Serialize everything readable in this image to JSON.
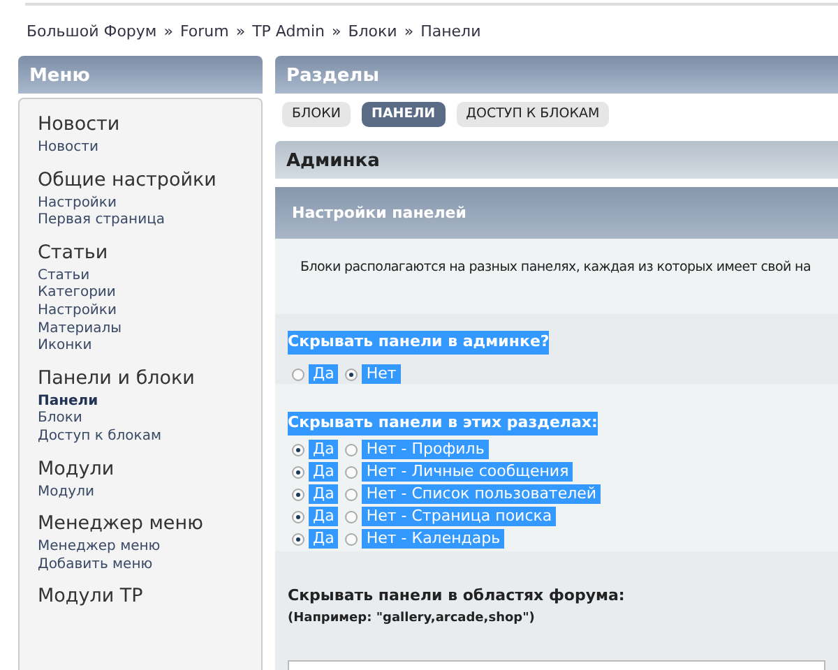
{
  "breadcrumb": {
    "separator": "»",
    "items": [
      "Большой Форум",
      "Forum",
      "TP Admin",
      "Блоки",
      "Панели"
    ]
  },
  "sidebar": {
    "title": "Меню",
    "sections": [
      {
        "title": "Новости",
        "items": [
          {
            "label": "Новости",
            "selected": false
          }
        ]
      },
      {
        "title": "Общие настройки",
        "items": [
          {
            "label": "Настройки",
            "selected": false
          },
          {
            "label": "Первая страница",
            "selected": false
          }
        ]
      },
      {
        "title": "Статьи",
        "items": [
          {
            "label": "Статьи",
            "selected": false
          },
          {
            "label": "Категории",
            "selected": false
          },
          {
            "label": "Настройки",
            "selected": false
          },
          {
            "label": "Материалы",
            "selected": false
          },
          {
            "label": "Иконки",
            "selected": false
          }
        ]
      },
      {
        "title": "Панели и блоки",
        "items": [
          {
            "label": "Панели",
            "selected": true
          },
          {
            "label": "Блоки",
            "selected": false
          },
          {
            "label": "Доступ к блокам",
            "selected": false
          }
        ]
      },
      {
        "title": "Модули",
        "items": [
          {
            "label": "Модули",
            "selected": false
          }
        ]
      },
      {
        "title": "Менеджер меню",
        "items": [
          {
            "label": "Менеджер меню",
            "selected": false
          },
          {
            "label": "Добавить меню",
            "selected": false
          }
        ]
      },
      {
        "title": "Модули TP"
      }
    ]
  },
  "main": {
    "title": "Разделы",
    "tabs": [
      {
        "label": "БЛОКИ",
        "selected": false
      },
      {
        "label": "ПАНЕЛИ",
        "selected": true
      },
      {
        "label": "ДОСТУП К БЛОКАМ",
        "selected": false
      }
    ],
    "subheader": "Админка",
    "panel": {
      "title": "Настройки панелей",
      "description": "Блоки располагаются на разных панелях, каждая из которых имеет свой на",
      "settings": [
        {
          "kind": "radio",
          "label": "Скрывать панели в админке?",
          "highlighted": true,
          "rows": [
            {
              "options": [
                {
                  "label": "Да",
                  "selected": false
                },
                {
                  "label": "Нет",
                  "selected": true
                }
              ]
            }
          ]
        },
        {
          "kind": "radio",
          "label": "Скрывать панели в этих разделах:",
          "highlighted": true,
          "rows": [
            {
              "options": [
                {
                  "label": "Да",
                  "selected": true
                },
                {
                  "label": "Нет - Профиль",
                  "selected": false
                }
              ]
            },
            {
              "options": [
                {
                  "label": "Да",
                  "selected": true
                },
                {
                  "label": "Нет - Личные сообщения",
                  "selected": false
                }
              ]
            },
            {
              "options": [
                {
                  "label": "Да",
                  "selected": true
                },
                {
                  "label": "Нет - Список пользователей",
                  "selected": false
                }
              ]
            },
            {
              "options": [
                {
                  "label": "Да",
                  "selected": true
                },
                {
                  "label": "Нет - Страница поиска",
                  "selected": false
                }
              ]
            },
            {
              "options": [
                {
                  "label": "Да",
                  "selected": true
                },
                {
                  "label": "Нет - Календарь",
                  "selected": false
                }
              ]
            }
          ]
        },
        {
          "kind": "textarea",
          "label": "Скрывать панели в областях форума:",
          "hint": "(Например: \"gallery,arcade,shop\")",
          "highlighted": false
        }
      ]
    }
  }
}
